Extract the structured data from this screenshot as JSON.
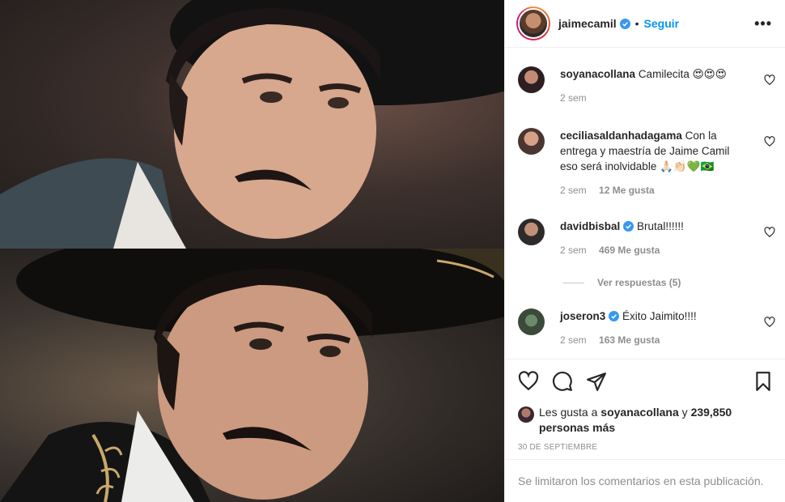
{
  "post": {
    "username": "jaimecamil",
    "follow_label": "Seguir",
    "separator": "•",
    "more_label": "•••"
  },
  "comments": [
    {
      "user": "soyanacollana",
      "text": "Camilecita 😍😍😍",
      "time": "2 sem",
      "likes": "",
      "verified": false
    },
    {
      "user": "ceciliasaldanhadagama",
      "text": "Con la entrega y maestría de Jaime Camil eso será inolvidable 🙏🏻👏🏻💚🇧🇷",
      "time": "2 sem",
      "likes": "12 Me gusta",
      "verified": false
    },
    {
      "user": "davidbisbal",
      "text": "Brutal!!!!!!",
      "time": "2 sem",
      "likes": "469 Me gusta",
      "verified": true
    },
    {
      "user": "joseron3",
      "text": "Éxito Jaimito!!!!",
      "time": "2 sem",
      "likes": "163 Me gusta",
      "verified": true
    }
  ],
  "replies_label": "Ver respuestas (5)",
  "likes_summary": {
    "prefix": "Les gusta a",
    "user": "soyanacollana",
    "conj": "y",
    "count": "239,850 personas más"
  },
  "date": "30 DE SEPTIEMBRE",
  "footer_text": "Se limitaron los comentarios en esta publicación.",
  "colors": {
    "accent": "#0095f6",
    "verified": "#3897f0",
    "muted": "#8e8e8e"
  }
}
